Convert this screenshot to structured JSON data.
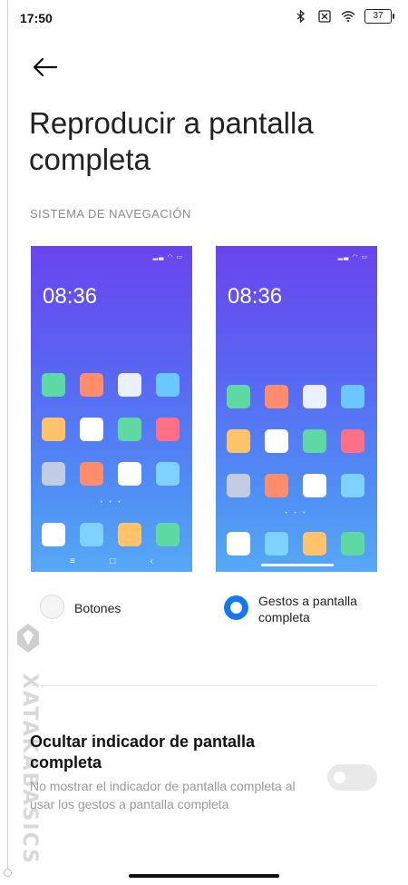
{
  "status_bar": {
    "time": "17:50",
    "battery": "37"
  },
  "page": {
    "title": "Reproducir a pantalla completa"
  },
  "section_header": "SISTEMA DE NAVEGACIÓN",
  "preview": {
    "clock": "08:36",
    "dots": "• • •",
    "nav_buttons": [
      "≡",
      "□",
      "‹"
    ]
  },
  "options": [
    {
      "label": "Botones",
      "selected": false
    },
    {
      "label": "Gestos a pantalla completa",
      "selected": true
    }
  ],
  "setting": {
    "title": "Ocultar indicador de pantalla completa",
    "description": "No mostrar el indicador de pantalla completa al usar los gestos a pantalla completa",
    "enabled": false
  },
  "watermark": {
    "text": "XATAKABASICS"
  },
  "colors": {
    "accent": "#1677f5"
  }
}
